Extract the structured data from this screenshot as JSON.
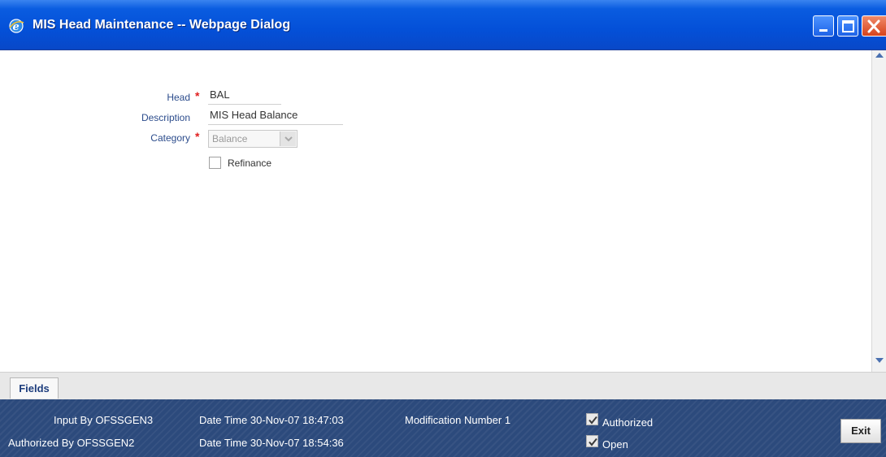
{
  "window": {
    "title": "MIS Head Maintenance -- Webpage Dialog"
  },
  "form": {
    "head_label": "Head",
    "head_value": "BAL",
    "description_label": "Description",
    "description_value": "MIS Head Balance",
    "category_label": "Category",
    "category_value": "Balance",
    "refinance_label": "Refinance",
    "required_mark": "*"
  },
  "tabs": [
    {
      "label": "Fields"
    }
  ],
  "footer": {
    "input_by_label": "Input By",
    "input_by_value": "OFSSGEN3",
    "input_datetime_label": "Date Time",
    "input_datetime_value": "30-Nov-07 18:47:03",
    "authorized_by_label": "Authorized By",
    "authorized_by_value": "OFSSGEN2",
    "auth_datetime_label": "Date Time",
    "auth_datetime_value": "30-Nov-07 18:54:36",
    "modification_label": "Modification Number",
    "modification_value": "1",
    "authorized_label": "Authorized",
    "open_label": "Open",
    "exit_label": "Exit"
  },
  "colors": {
    "titlebar": "#0450d8",
    "footer": "#2c4a7c",
    "label": "#2c4c8c",
    "required": "#e02020"
  },
  "icons": [
    "ie-icon",
    "minimize-icon",
    "maximize-icon",
    "close-icon",
    "scroll-up-icon",
    "scroll-down-icon",
    "chevron-down-icon",
    "check-icon"
  ]
}
